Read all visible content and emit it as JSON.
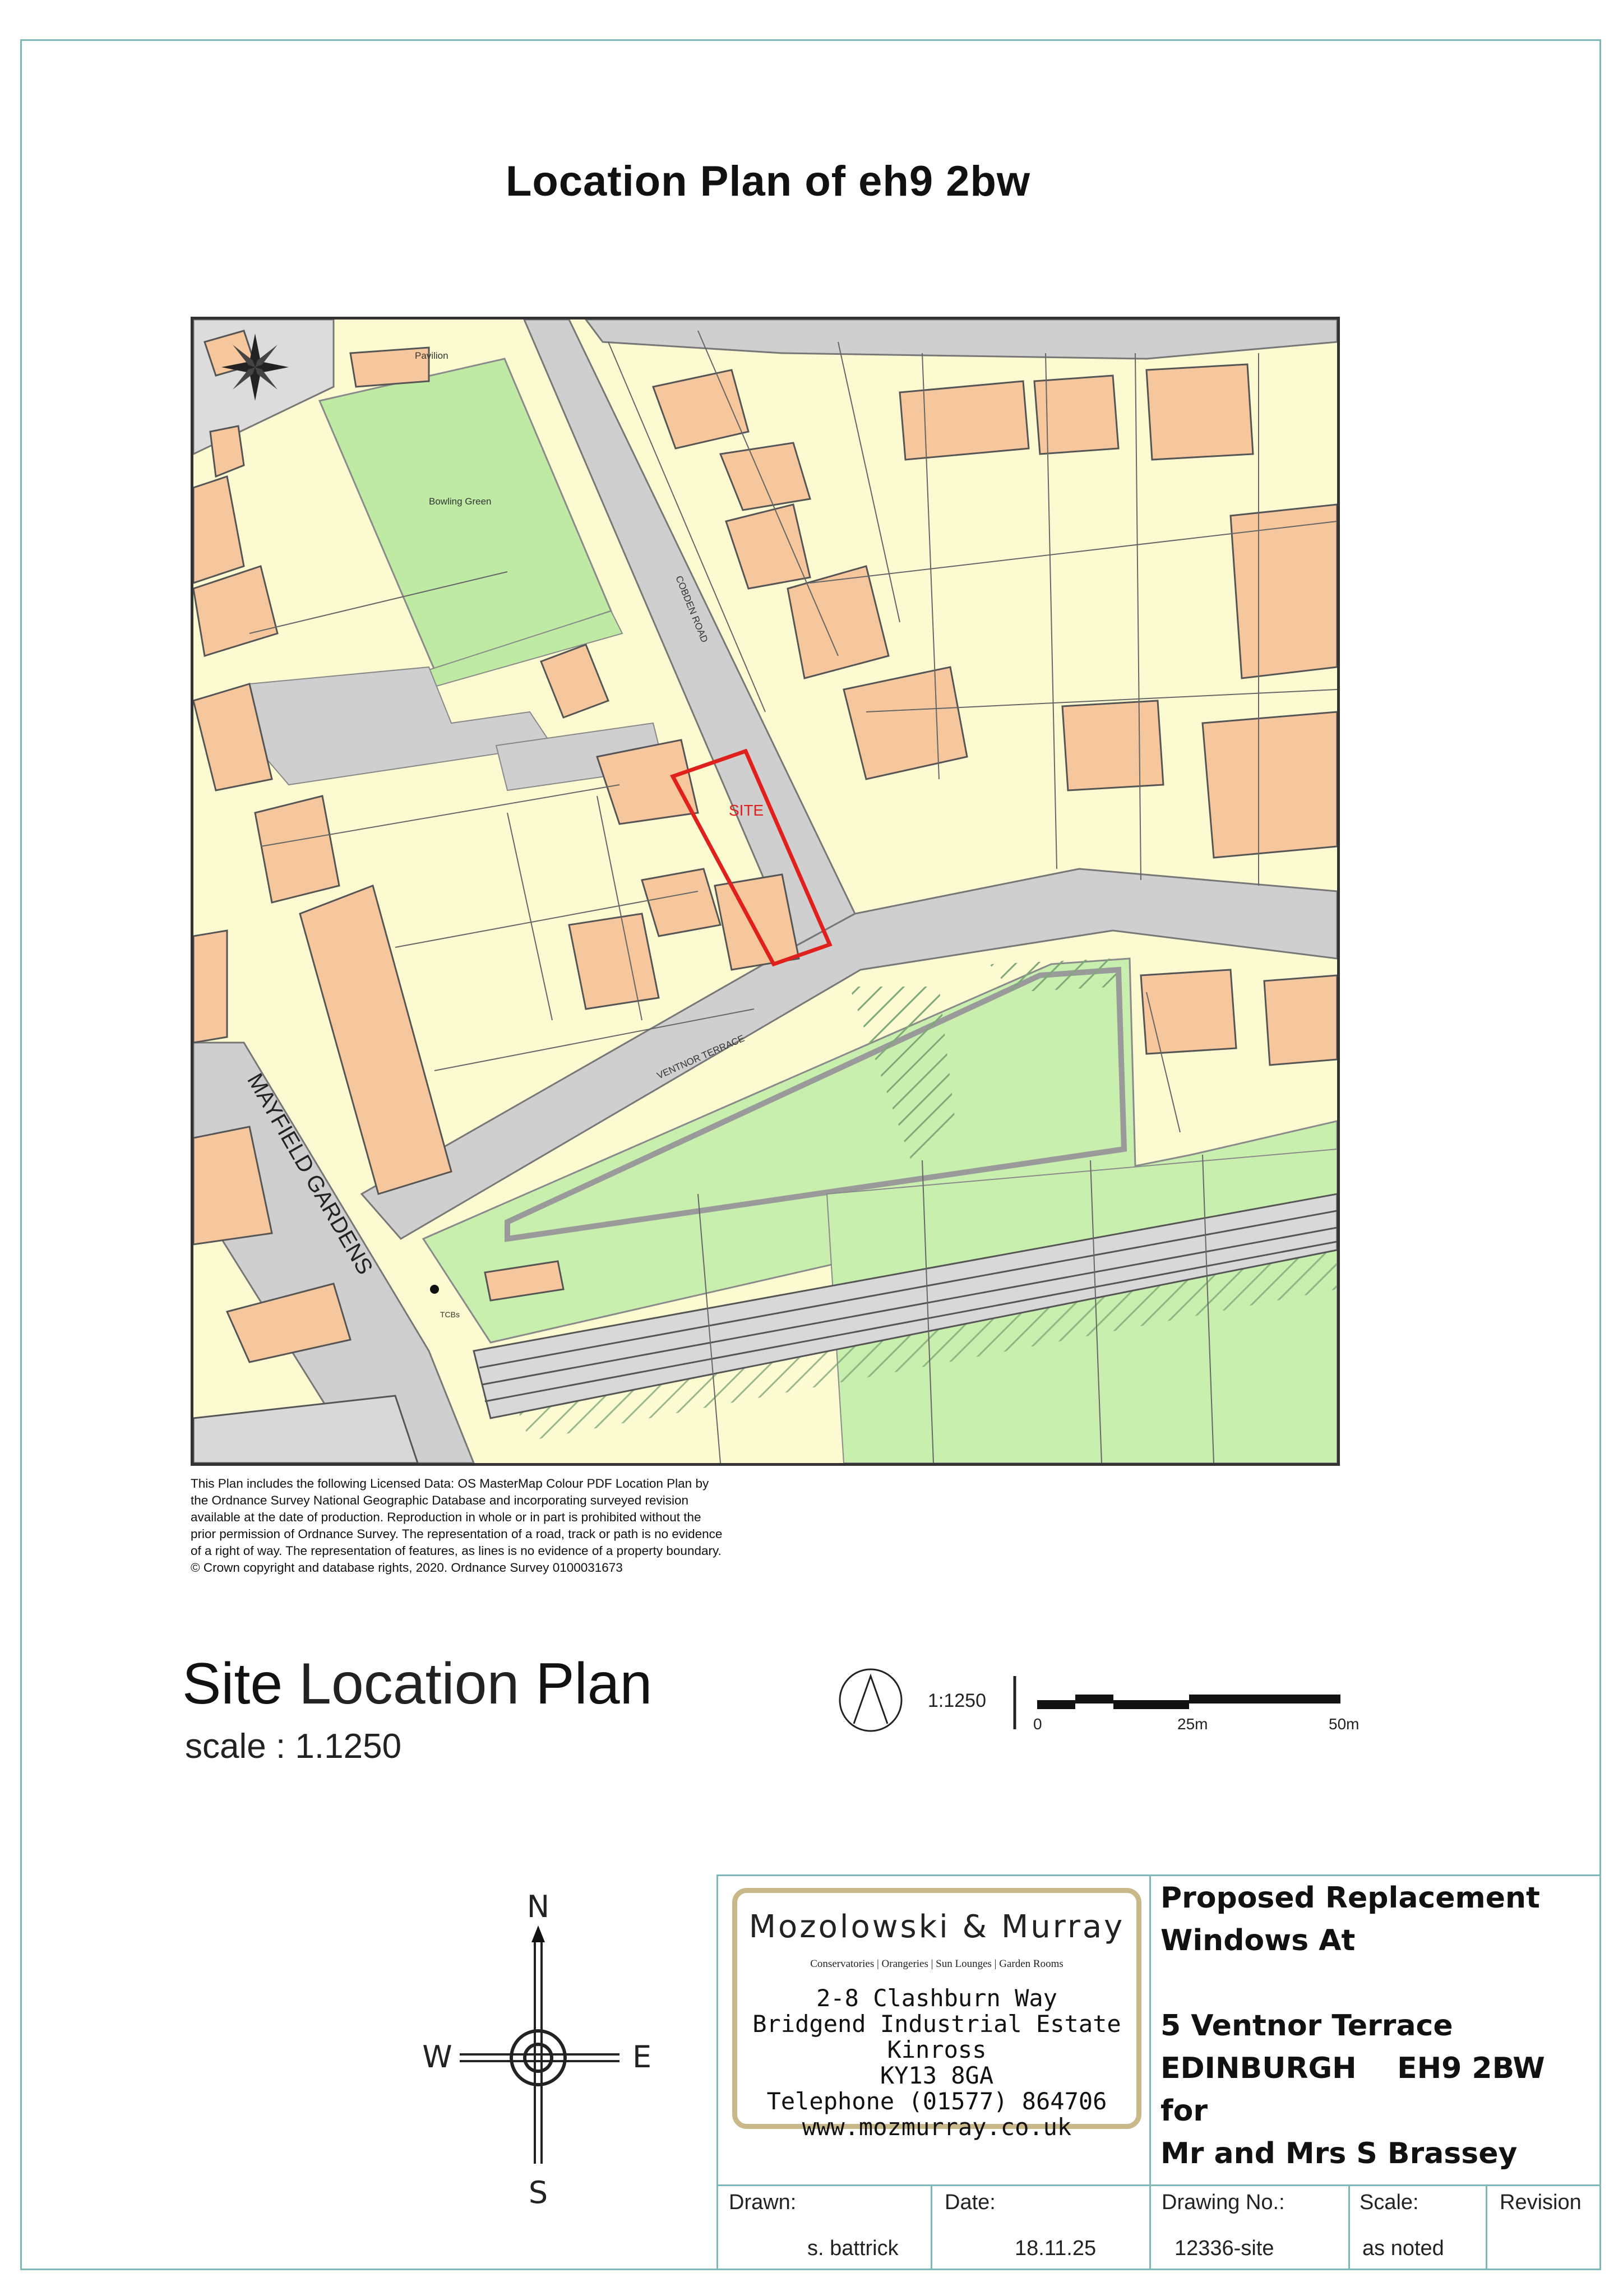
{
  "title": "Location Plan of eh9 2bw",
  "map": {
    "labels": {
      "pavilion": "Pavilion",
      "bowling_green": "Bowling Green",
      "cobden_road": "COBDEN ROAD",
      "ventnor_terrace": "VENTNOR TERRACE",
      "mayfield_gardens": "MAYFIELD   GARDENS",
      "site": "SITE",
      "tcbs": "TCBs"
    },
    "colors": {
      "land": "#fbfad0",
      "buildings": "#f6c79c",
      "roads": "#cfcfcf",
      "green": "#bfeaa3",
      "site_outline": "#e0201c"
    }
  },
  "licence": "This Plan includes the following Licensed Data: OS MasterMap Colour PDF Location Plan by the Ordnance Survey National Geographic Database and incorporating surveyed revision available at the date of production. Reproduction in whole or in part is prohibited without the prior permission of Ordnance Survey. The representation of a road, track or path is no evidence of a right of way. The representation of features, as lines is no evidence of a property boundary. © Crown copyright and database rights, 2020. Ordnance Survey 0100031673",
  "site_plan": {
    "heading_bold1": "Site",
    "heading_thin": " Location ",
    "heading_bold2": "Plan",
    "scale": "scale : 1.1250"
  },
  "scalebar": {
    "ratio": "1:1250",
    "ticks": [
      "0",
      "25m",
      "50m"
    ]
  },
  "compass": {
    "n": "N",
    "s": "S",
    "e": "E",
    "w": "W"
  },
  "company": {
    "name": "Mozolowski  &  Murray",
    "tagline": "Conservatories | Orangeries | Sun Lounges | Garden Rooms",
    "address": [
      "2-8 Clashburn Way",
      "Bridgend Industrial Estate",
      "Kinross",
      "KY13 8GA",
      "Telephone (01577) 864706",
      "www.mozmurray.co.uk"
    ]
  },
  "project": {
    "line1": "Proposed Replacement",
    "line2": "Windows At",
    "line3": "",
    "line4": "5 Ventnor Terrace",
    "line5": "EDINBURGH    EH9 2BW",
    "line6": "for",
    "line7": "Mr and Mrs S Brassey"
  },
  "footer": {
    "drawn_label": "Drawn:",
    "drawn_value": "s. battrick",
    "date_label": "Date:",
    "date_value": "18.11.25",
    "drawing_no_label": "Drawing No.:",
    "drawing_no_value": "12336-site",
    "scale_label": "Scale:",
    "scale_value": "as noted",
    "revision_label": "Revision"
  }
}
